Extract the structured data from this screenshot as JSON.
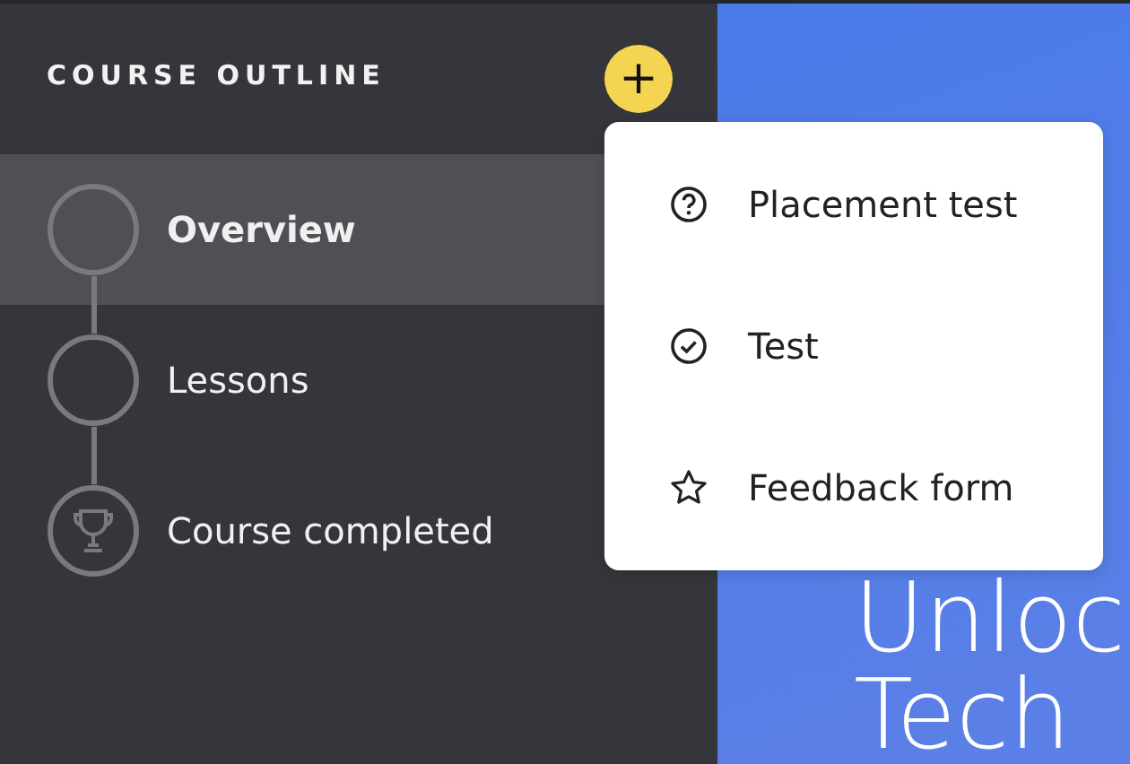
{
  "sidebar": {
    "title": "COURSE OUTLINE",
    "add_button": "+",
    "steps": [
      {
        "label": "Overview",
        "kind": "circle",
        "selected": true
      },
      {
        "label": "Lessons",
        "kind": "circle",
        "selected": false
      },
      {
        "label": "Course completed",
        "kind": "trophy",
        "selected": false
      }
    ]
  },
  "menu": {
    "items": [
      {
        "label": "Placement test",
        "kind": "question"
      },
      {
        "label": "Test",
        "kind": "check"
      },
      {
        "label": "Feedback form",
        "kind": "star"
      }
    ]
  },
  "hero": {
    "lines": [
      "Unloc",
      "Tech"
    ]
  }
}
